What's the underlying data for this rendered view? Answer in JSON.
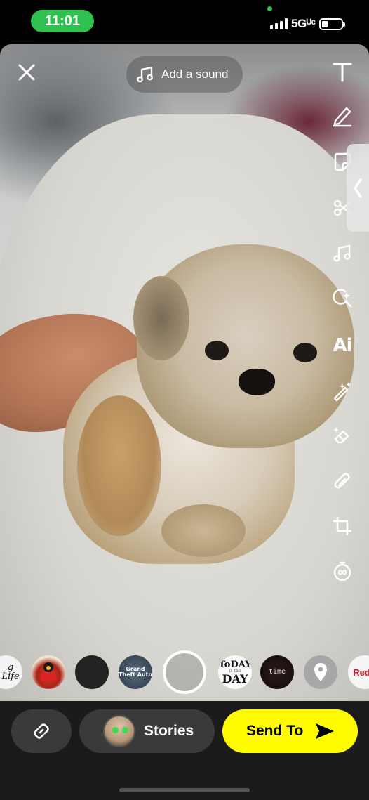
{
  "status_bar": {
    "time": "11:01",
    "network": "5Gᵁᶜ",
    "colors": {
      "time_pill": "#30c04f"
    }
  },
  "top": {
    "close_icon": "close-icon",
    "sound_label": "Add a sound",
    "sound_icon": "music-note-icon"
  },
  "tools": [
    {
      "name": "text-tool",
      "icon": "T"
    },
    {
      "name": "draw-tool",
      "icon": "pencil-icon"
    },
    {
      "name": "sticker-tool",
      "icon": "sticker-icon"
    },
    {
      "name": "scissors-tool",
      "icon": "scissors-icon"
    },
    {
      "name": "music-tool",
      "icon": "music-note-icon"
    },
    {
      "name": "lens-search-tool",
      "icon": "search-sparkle-icon"
    },
    {
      "name": "ai-tool",
      "label": "Ai"
    },
    {
      "name": "magic-wand-tool",
      "icon": "magic-wand-icon"
    },
    {
      "name": "eraser-tool",
      "icon": "eraser-sparkle-icon"
    },
    {
      "name": "attach-tool",
      "icon": "paperclip-icon"
    },
    {
      "name": "crop-tool",
      "icon": "crop-icon"
    },
    {
      "name": "timer-tool",
      "icon": "timer-infinity-icon"
    }
  ],
  "lenses": [
    {
      "name": "lens-thug-life",
      "label": "g Life"
    },
    {
      "name": "lens-cartoon",
      "label": ""
    },
    {
      "name": "lens-black",
      "label": ""
    },
    {
      "name": "lens-gta",
      "label": "Grand Theft Auto"
    },
    {
      "name": "lens-selected",
      "label": ""
    },
    {
      "name": "lens-today-day",
      "label_top": "ToDAY",
      "label_mid": "is the",
      "label_bottom": "DAY"
    },
    {
      "name": "lens-time",
      "label": "time"
    },
    {
      "name": "lens-location",
      "label": ""
    },
    {
      "name": "lens-redbull",
      "label": "Red B"
    }
  ],
  "bottom": {
    "link_icon": "link-icon",
    "stories_label": "Stories",
    "send_label": "Send To",
    "colors": {
      "send_button": "#fffc00",
      "bar": "#1b1b1b",
      "pill": "#3a3a3a"
    }
  }
}
